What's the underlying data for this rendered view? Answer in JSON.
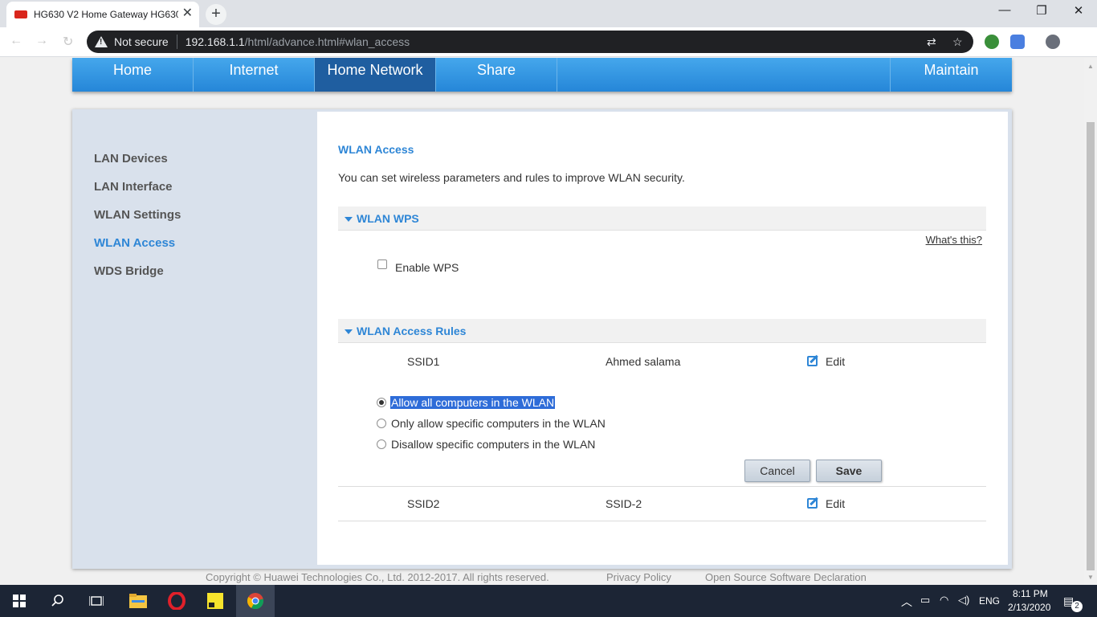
{
  "browser": {
    "tab_title": "HG630 V2 Home Gateway HG630",
    "tab_close": "✕",
    "new_tab": "+",
    "security_text": "Not secure",
    "url_host": "192.168.1.1",
    "url_path": "/html/advance.html#wlan_access",
    "window_controls": {
      "minimize": "—",
      "restore": "❐",
      "close": "✕"
    }
  },
  "topnav": {
    "items": [
      "Home",
      "Internet",
      "Home Network",
      "Share",
      "Maintain"
    ],
    "active": "Home Network"
  },
  "sidebar": {
    "items": [
      "LAN Devices",
      "LAN Interface",
      "WLAN Settings",
      "WLAN Access",
      "WDS Bridge"
    ],
    "active": "WLAN Access"
  },
  "main": {
    "title": "WLAN Access",
    "description": "You can set wireless parameters and rules to improve WLAN security.",
    "wps_section": {
      "label": "WLAN WPS",
      "whats_this": "What's this?",
      "enable_label": "Enable WPS",
      "enabled": false
    },
    "rules_section": {
      "label": "WLAN Access Rules",
      "rows": [
        {
          "ssid": "SSID1",
          "name": "Ahmed salama",
          "action": "Edit"
        },
        {
          "ssid": "SSID2",
          "name": "SSID-2",
          "action": "Edit"
        }
      ],
      "options": [
        "Allow all computers in the WLAN",
        "Only allow specific computers in the WLAN",
        "Disallow specific computers in the WLAN"
      ],
      "selected_option": "Allow all computers in the WLAN",
      "cancel_label": "Cancel",
      "save_label": "Save"
    }
  },
  "footer": {
    "copyright": "Copyright © Huawei Technologies Co., Ltd. 2012-2017. All rights reserved.",
    "privacy": "Privacy Policy",
    "open_source": "Open Source Software Declaration"
  },
  "taskbar": {
    "language": "ENG",
    "time": "8:11 PM",
    "date": "2/13/2020",
    "notification_count": "2"
  },
  "colors": {
    "accent": "#2e86d6",
    "nav_active": "#1f5ea0",
    "panel_bg": "#d9e1ec"
  }
}
